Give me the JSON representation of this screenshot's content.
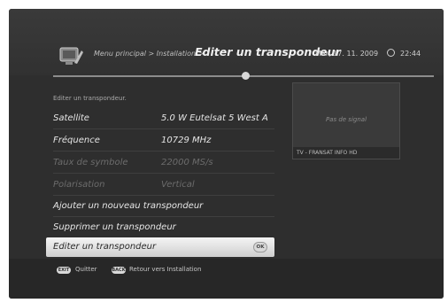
{
  "header": {
    "breadcrumb_main": "Menu principal > Installation >",
    "title": "Editer un transpondeur",
    "date": "Mar, 17. 11. 2009",
    "time": "22:44"
  },
  "subtitle": "Editer un transpondeur.",
  "fields": [
    {
      "label": "Satellite",
      "value": "5.0 W Eutelsat 5 West A"
    },
    {
      "label": "Fréquence",
      "value": "10729 MHz"
    },
    {
      "label": "Taux de symbole",
      "value": "22000 MS/s"
    },
    {
      "label": "Polarisation",
      "value": "Vertical"
    }
  ],
  "actions": [
    {
      "label": "Ajouter un nouveau transpondeur"
    },
    {
      "label": "Supprimer un transpondeur"
    },
    {
      "label": "Editer un transpondeur",
      "badge": "OK"
    }
  ],
  "preview": {
    "status": "Pas de signal",
    "channel": "TV - FRANSAT INFO HD"
  },
  "footer": {
    "exit_key": "EXIT",
    "exit_label": "Quitter",
    "back_key": "BACK",
    "back_label": "Retour vers Installation"
  }
}
